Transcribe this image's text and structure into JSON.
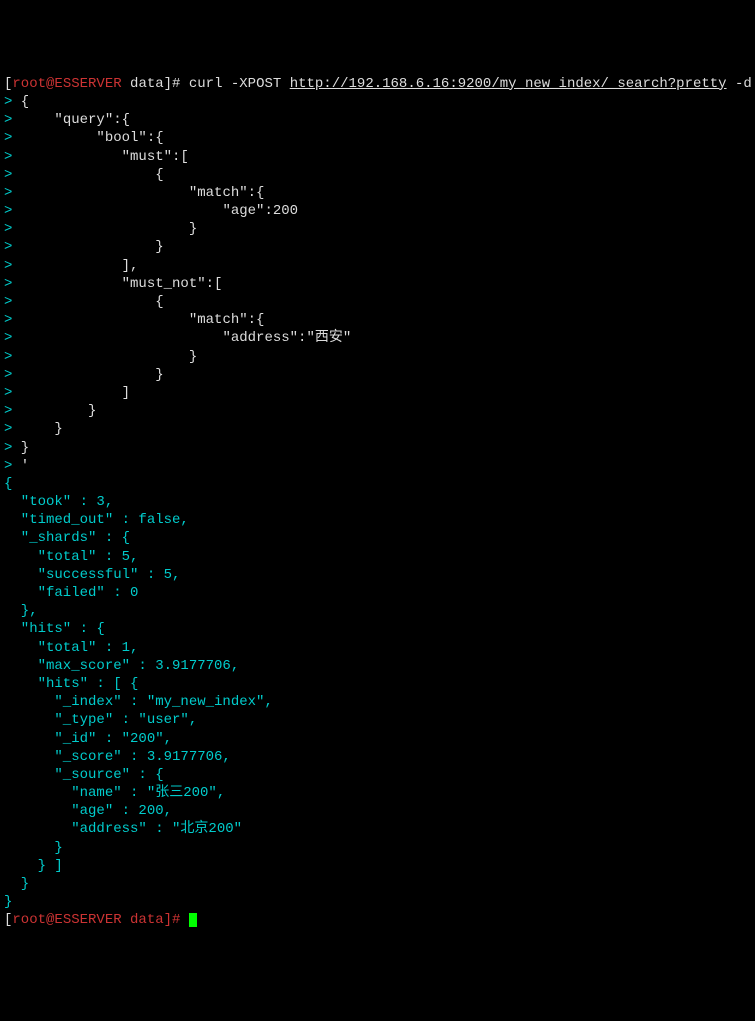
{
  "prompt": {
    "user": "root",
    "at": "@",
    "host": "ESSERVER",
    "dir": "data",
    "hash": "]#",
    "cmd_prefix": "curl -XPOST ",
    "url": "http://192.168.6.16:9200/my_new_index/_search?pretty",
    "cmd_suffix": " -d '"
  },
  "cont": ">",
  "input_lines": [
    " {",
    "     \"query\":{",
    "          \"bool\":{",
    "             \"must\":[",
    "                 {",
    "                     \"match\":{",
    "                         \"age\":200",
    "                     }",
    "                 }",
    "             ],",
    "             \"must_not\":[",
    "                 {",
    "                     \"match\":{",
    "                         \"address\":\"西安\"",
    "                     }",
    "                 }",
    "             ]",
    "         }",
    "     }",
    " }",
    " '"
  ],
  "output_lines": [
    "{",
    "  \"took\" : 3,",
    "  \"timed_out\" : false,",
    "  \"_shards\" : {",
    "    \"total\" : 5,",
    "    \"successful\" : 5,",
    "    \"failed\" : 0",
    "  },",
    "  \"hits\" : {",
    "    \"total\" : 1,",
    "    \"max_score\" : 3.9177706,",
    "    \"hits\" : [ {",
    "      \"_index\" : \"my_new_index\",",
    "      \"_type\" : \"user\",",
    "      \"_id\" : \"200\",",
    "      \"_score\" : 3.9177706,",
    "      \"_source\" : {",
    "        \"name\" : \"张三200\",",
    "        \"age\" : 200,",
    "        \"address\" : \"北京200\"",
    "      }",
    "    } ]",
    "  }",
    "}"
  ],
  "last_prompt_partial": {
    "open_bracket": "[",
    "rest": "root@ESSERVER data]# "
  }
}
